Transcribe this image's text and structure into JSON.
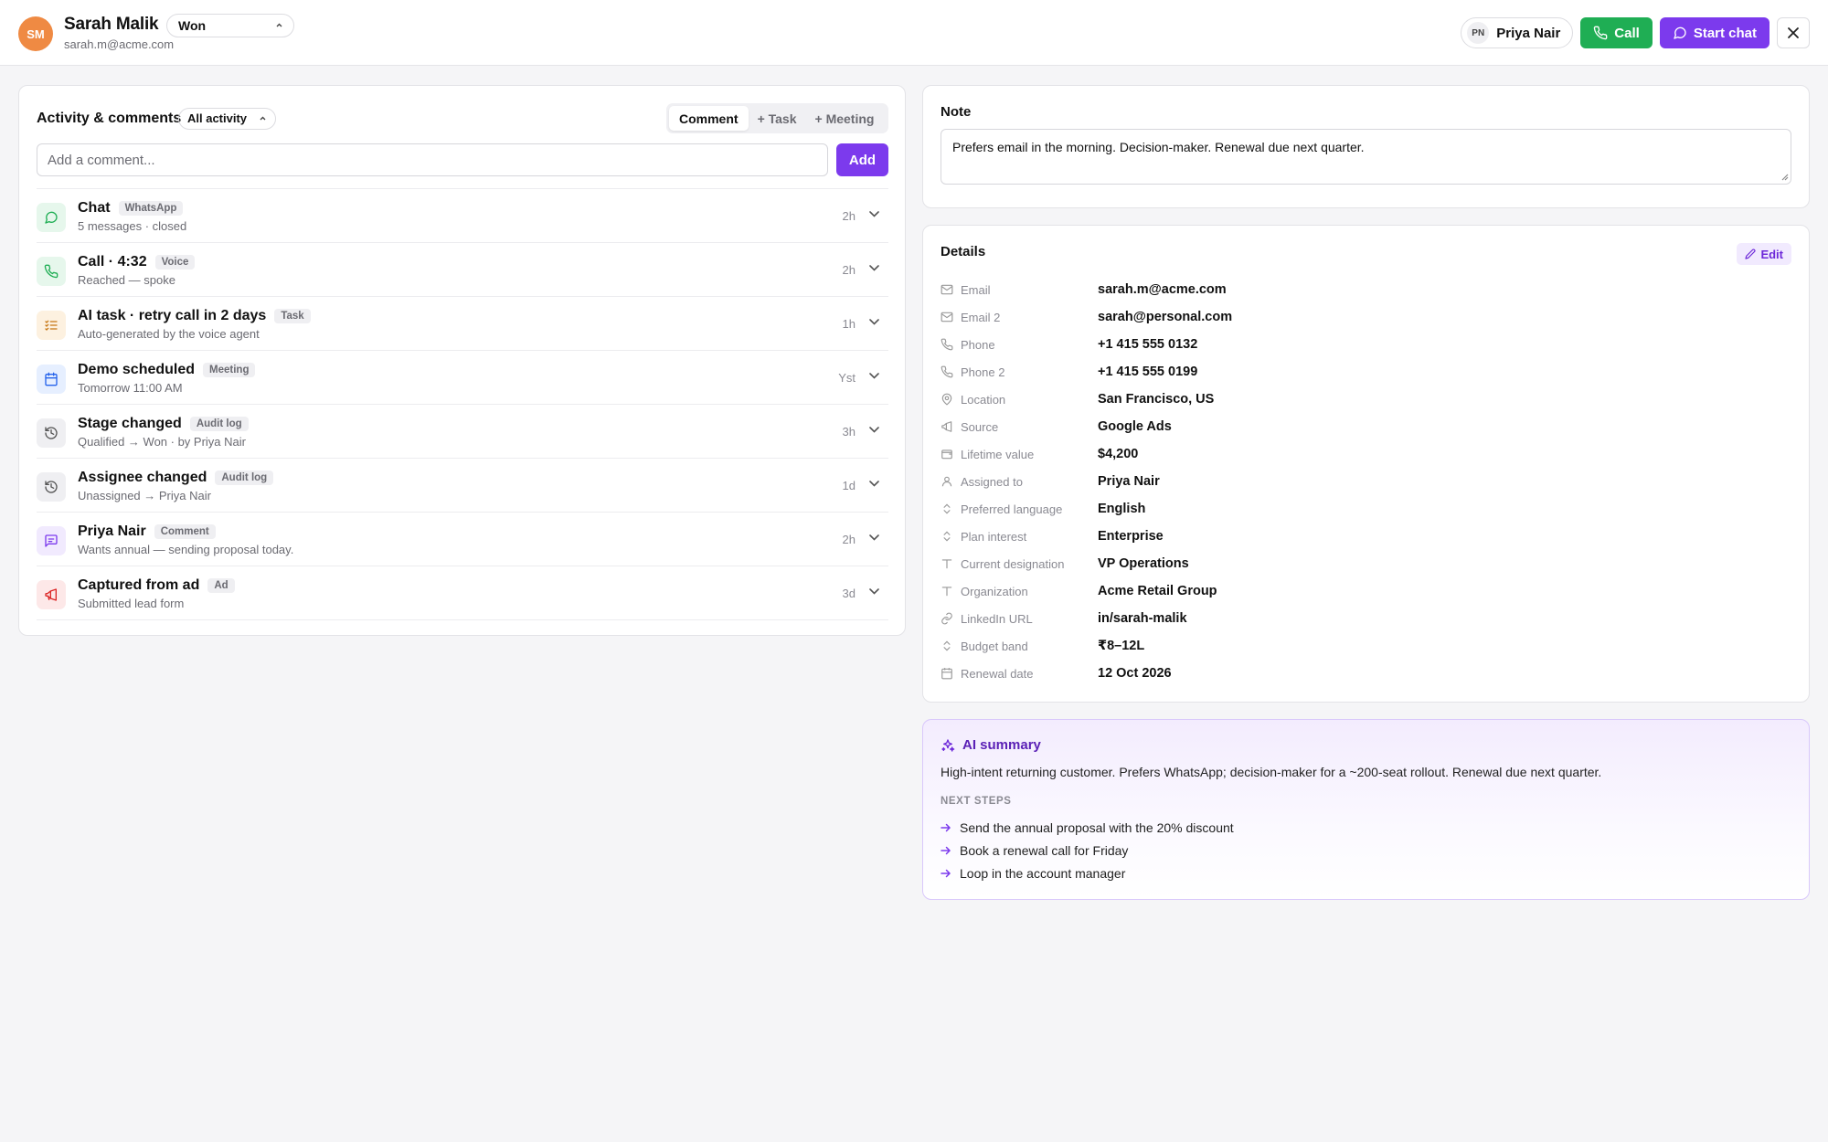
{
  "header": {
    "avatar_initials": "SM",
    "name": "Sarah Malik",
    "email": "sarah.m@acme.com",
    "stage": "Won",
    "assignee_initials": "PN",
    "assignee_name": "Priya Nair",
    "call_label": "Call",
    "chat_label": "Start chat"
  },
  "colors": {
    "accent": "#7c3aed",
    "call_green": "#1fae54",
    "avatar_orange": "#ef8a43"
  },
  "activity": {
    "title": "Activity & comments",
    "filter": "All activity",
    "tabs": [
      {
        "label": "Comment",
        "active": true
      },
      {
        "label": "+ Task",
        "active": false
      },
      {
        "label": "+ Meeting",
        "active": false
      }
    ],
    "comment_placeholder": "Add a comment...",
    "add_label": "Add",
    "items": [
      {
        "title": "Chat",
        "tag": "WhatsApp",
        "subtitle": "5 messages · closed",
        "time": "2h",
        "icon": "chat-icon"
      },
      {
        "title": "Call · 4:32",
        "tag": "Voice",
        "subtitle": "Reached — spoke",
        "time": "2h",
        "icon": "phone-icon"
      },
      {
        "title": "AI task · retry call in 2 days",
        "tag": "Task",
        "subtitle": "Auto-generated by the voice agent",
        "time": "1h",
        "icon": "task-list-icon"
      },
      {
        "title": "Demo scheduled",
        "tag": "Meeting",
        "subtitle": "Tomorrow 11:00 AM",
        "time": "Yst",
        "icon": "calendar-icon"
      },
      {
        "title": "Stage changed",
        "tag": "Audit log",
        "subtitle": "Qualified → Won · by Priya Nair",
        "time": "3h",
        "icon": "history-icon"
      },
      {
        "title": "Assignee changed",
        "tag": "Audit log",
        "subtitle": "Unassigned → Priya Nair",
        "time": "1d",
        "icon": "history-icon"
      },
      {
        "title": "Priya Nair",
        "tag": "Comment",
        "subtitle": "Wants annual — sending proposal today.",
        "time": "2h",
        "icon": "comment-icon"
      },
      {
        "title": "Captured from ad",
        "tag": "Ad",
        "subtitle": "Submitted lead form",
        "time": "3d",
        "icon": "megaphone-icon"
      }
    ]
  },
  "note": {
    "title": "Note",
    "text": "Prefers email in the morning. Decision-maker. Renewal due next quarter."
  },
  "details": {
    "title": "Details",
    "edit_label": "Edit",
    "fields": [
      {
        "label": "Email",
        "value": "sarah.m@acme.com",
        "icon": "mail-icon"
      },
      {
        "label": "Email 2",
        "value": "sarah@personal.com",
        "icon": "mail-icon"
      },
      {
        "label": "Phone",
        "value": "+1 415 555 0132",
        "icon": "phone-icon"
      },
      {
        "label": "Phone 2",
        "value": "+1 415 555 0199",
        "icon": "phone-icon"
      },
      {
        "label": "Location",
        "value": "San Francisco, US",
        "icon": "location-pin-icon"
      },
      {
        "label": "Source",
        "value": "Google Ads",
        "icon": "megaphone-icon"
      },
      {
        "label": "Lifetime value",
        "value": "$4,200",
        "icon": "wallet-icon"
      },
      {
        "label": "Assigned to",
        "value": "Priya Nair",
        "icon": "user-icon"
      },
      {
        "label": "Preferred language",
        "value": "English",
        "icon": "updown-icon"
      },
      {
        "label": "Plan interest",
        "value": "Enterprise",
        "icon": "updown-icon"
      },
      {
        "label": "Current designation",
        "value": "VP Operations",
        "icon": "text-icon"
      },
      {
        "label": "Organization",
        "value": "Acme Retail Group",
        "icon": "text-icon"
      },
      {
        "label": "LinkedIn URL",
        "value": "in/sarah-malik",
        "icon": "link-icon"
      },
      {
        "label": "Budget band",
        "value": "₹8–12L",
        "icon": "updown-icon"
      },
      {
        "label": "Renewal date",
        "value": "12 Oct 2026",
        "icon": "calendar-icon"
      }
    ]
  },
  "ai_summary": {
    "title": "AI summary",
    "text": "High-intent returning customer. Prefers WhatsApp; decision-maker for a ~200-seat rollout. Renewal due next quarter.",
    "next_steps_label": "NEXT STEPS",
    "steps": [
      "Send the annual proposal with the 20% discount",
      "Book a renewal call for Friday",
      "Loop in the account manager"
    ]
  }
}
